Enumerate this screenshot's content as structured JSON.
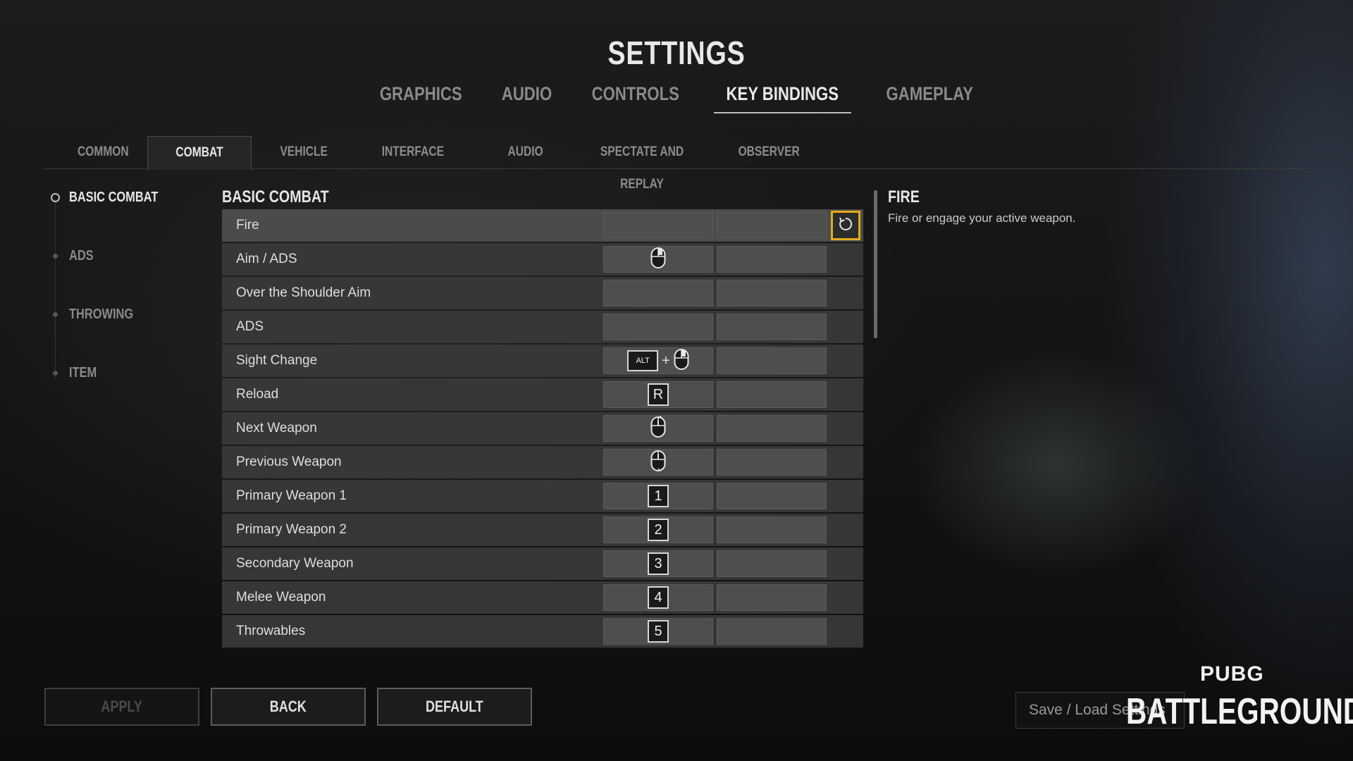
{
  "header": {
    "title": "SETTINGS"
  },
  "top_tabs": [
    {
      "label": "GRAPHICS",
      "active": false
    },
    {
      "label": "AUDIO",
      "active": false
    },
    {
      "label": "CONTROLS",
      "active": false
    },
    {
      "label": "KEY BINDINGS",
      "active": true
    },
    {
      "label": "GAMEPLAY",
      "active": false
    }
  ],
  "sub_tabs": [
    {
      "label": "COMMON",
      "active": false
    },
    {
      "label": "COMBAT",
      "active": true
    },
    {
      "label": "VEHICLE",
      "active": false
    },
    {
      "label": "INTERFACE",
      "active": false
    },
    {
      "label": "AUDIO",
      "active": false
    },
    {
      "label": "SPECTATE AND REPLAY",
      "active": false
    },
    {
      "label": "OBSERVER",
      "active": false
    }
  ],
  "side_nav": [
    {
      "label": "BASIC COMBAT",
      "active": true
    },
    {
      "label": "ADS",
      "active": false
    },
    {
      "label": "THROWING",
      "active": false
    },
    {
      "label": "ITEM",
      "active": false
    }
  ],
  "section": {
    "title": "BASIC COMBAT"
  },
  "bindings": [
    {
      "action": "Fire",
      "primary": "",
      "primary_type": "none",
      "selected": true
    },
    {
      "action": "Aim / ADS",
      "primary": "mouse-right-icon",
      "primary_type": "mouse"
    },
    {
      "action": "Over the Shoulder Aim",
      "primary": "",
      "primary_type": "none"
    },
    {
      "action": "ADS",
      "primary": "",
      "primary_type": "none"
    },
    {
      "action": "Sight Change",
      "primary": "ALT",
      "primary_type": "combo",
      "combo_icon": "mouse-right-icon"
    },
    {
      "action": "Reload",
      "primary": "R",
      "primary_type": "key"
    },
    {
      "action": "Next Weapon",
      "primary": "mouse-wheel-up-icon",
      "primary_type": "mouse"
    },
    {
      "action": "Previous Weapon",
      "primary": "mouse-wheel-down-icon",
      "primary_type": "mouse"
    },
    {
      "action": "Primary Weapon 1",
      "primary": "1",
      "primary_type": "key"
    },
    {
      "action": "Primary Weapon 2",
      "primary": "2",
      "primary_type": "key"
    },
    {
      "action": "Secondary Weapon",
      "primary": "3",
      "primary_type": "key"
    },
    {
      "action": "Melee Weapon",
      "primary": "4",
      "primary_type": "key"
    },
    {
      "action": "Throwables",
      "primary": "5",
      "primary_type": "key"
    }
  ],
  "combo_plus": "+",
  "description": {
    "title": "FIRE",
    "text": "Fire or engage your active weapon."
  },
  "buttons": {
    "apply": "APPLY",
    "back": "BACK",
    "default": "DEFAULT"
  },
  "save_load": "Save / Load Settings",
  "logo": {
    "line1": "PUBG",
    "line2": "BATTLEGROUNDS"
  },
  "colors": {
    "accent": "#e5a91c"
  }
}
